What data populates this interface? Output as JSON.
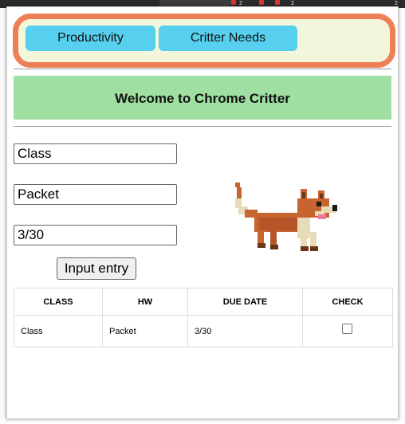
{
  "nav": {
    "tabs": [
      {
        "label": "Productivity"
      },
      {
        "label": "Critter Needs"
      }
    ]
  },
  "banner": {
    "title": "Welcome to Chrome Critter"
  },
  "form": {
    "class_value": "Class",
    "hw_value": "Packet",
    "due_value": "3/30",
    "submit_label": "Input entry"
  },
  "table": {
    "headers": [
      "CLASS",
      "HW",
      "DUE DATE",
      "CHECK"
    ],
    "rows": [
      {
        "class": "Class",
        "hw": "Packet",
        "due": "3/30",
        "checked": false
      }
    ]
  },
  "browser_strip": {
    "badges": [
      "2",
      "2",
      "2"
    ]
  },
  "colors": {
    "nav_border": "#ec7f55",
    "nav_background": "#f4f6dc",
    "tab_button": "#56d0ee",
    "banner": "#9fdfa1"
  },
  "critter": {
    "icon": "fox-sprite-icon"
  }
}
